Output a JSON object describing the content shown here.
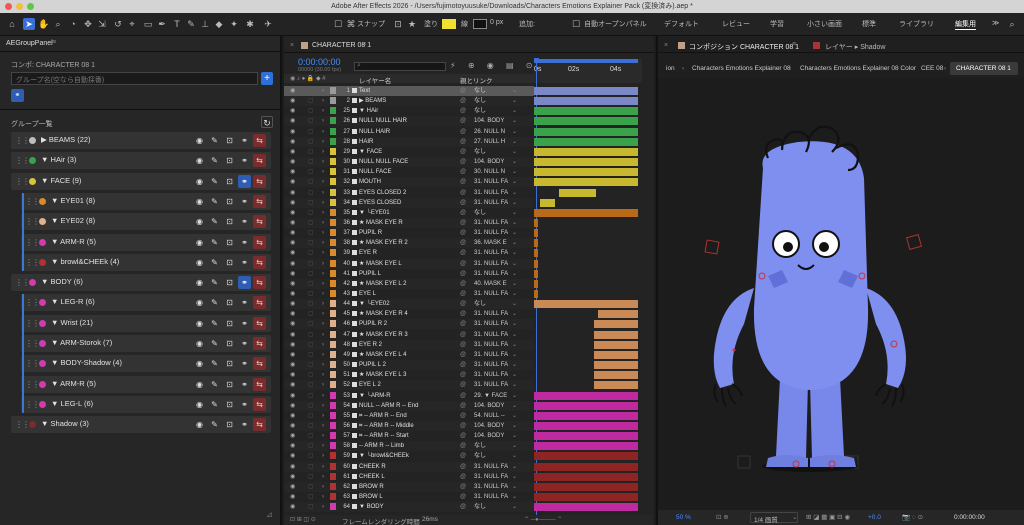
{
  "window": {
    "title": "Adobe After Effects 2026 - /Users/fujimotoyuusuke/Downloads/Characters Emotions Explainer Pack (変換済み).aep *"
  },
  "toolbar": {
    "snap_label": "スナップ",
    "fill_label": "塗り",
    "stroke_px": "0 px",
    "add_label": "追加:",
    "auto_open_label": "自動オープンパネル",
    "workspaces": [
      "デフォルト",
      "レビュー",
      "学習",
      "小さい画面",
      "標準",
      "ライブラリ",
      "編集用"
    ]
  },
  "left_panel": {
    "tab": "AEGroupPanel",
    "comp_label": "コンポ: CHARACTER 08 1",
    "group_name_placeholder": "グループ名(空なら自動採番)",
    "group_list_label": "グループ一覧",
    "groups": [
      {
        "name": "BEAMS (22)",
        "color": "#bdbdbd",
        "arrow": "▶",
        "indent": 0
      },
      {
        "name": "HAir (3)",
        "color": "#3aa24a",
        "arrow": "▼",
        "indent": 0
      },
      {
        "name": "FACE (9)",
        "color": "#d8c33a",
        "arrow": "▼",
        "indent": 0
      },
      {
        "name": "EYE01 (8)",
        "color": "#d98a2a",
        "arrow": "▼",
        "indent": 1
      },
      {
        "name": "EYE02 (8)",
        "color": "#e0b08a",
        "arrow": "▼",
        "indent": 1
      },
      {
        "name": "ARM-R (5)",
        "color": "#d23ab0",
        "arrow": "▼",
        "indent": 1
      },
      {
        "name": "browl&CHEEk (4)",
        "color": "#b23232",
        "arrow": "▼",
        "indent": 1
      },
      {
        "name": "BODY (6)",
        "color": "#d23ab0",
        "arrow": "▼",
        "indent": 0
      },
      {
        "name": "LEG-R (6)",
        "color": "#d23ab0",
        "arrow": "▼",
        "indent": 1
      },
      {
        "name": "Wrist (21)",
        "color": "#d23ab0",
        "arrow": "▼",
        "indent": 1
      },
      {
        "name": "ARM-Storok (7)",
        "color": "#d23ab0",
        "arrow": "▼",
        "indent": 1
      },
      {
        "name": "BODY-Shadow (4)",
        "color": "#d23ab0",
        "arrow": "▼",
        "indent": 1
      },
      {
        "name": "ARM-R (5)",
        "color": "#d23ab0",
        "arrow": "▼",
        "indent": 1
      },
      {
        "name": "LEG-L (6)",
        "color": "#d23ab0",
        "arrow": "▼",
        "indent": 1
      },
      {
        "name": "Shadow (3)",
        "color": "#7a2c2c",
        "arrow": "▼",
        "indent": 0
      }
    ]
  },
  "timeline": {
    "tab": "CHARACTER 08 1",
    "timecode": "0:00:00:00",
    "fps": "00000 (30.00 fps)",
    "col_layer_name": "レイヤー名",
    "col_parent": "親とリンク",
    "ruler": [
      "0s",
      "02s",
      "04s"
    ],
    "footer": "フレームレンダリング時間",
    "footer_time": "26ms",
    "layers": [
      {
        "n": "1",
        "name": "Text",
        "parent": "なし",
        "col": "#9a9a9a",
        "bar": "#7a88c8",
        "b0": 0,
        "b1": 100,
        "sel": true
      },
      {
        "n": "2",
        "name": "▶ BEAMS",
        "parent": "なし",
        "col": "#9a9a9a",
        "bar": "#7a88c8",
        "b0": 0,
        "b1": 100
      },
      {
        "n": "25",
        "name": "▼ HAir",
        "parent": "なし",
        "col": "#3aa24a",
        "bar": "#3aa24a",
        "b0": 0,
        "b1": 100
      },
      {
        "n": "26",
        "name": "NULL NULL HAIR",
        "parent": "104. BODY",
        "col": "#3aa24a",
        "bar": "#3aa24a",
        "b0": 0,
        "b1": 100
      },
      {
        "n": "27",
        "name": "NULL HAIR",
        "parent": "26. NULL N",
        "col": "#3aa24a",
        "bar": "#3aa24a",
        "b0": 0,
        "b1": 100
      },
      {
        "n": "28",
        "name": "HAIR",
        "parent": "27. NULL H",
        "col": "#3aa24a",
        "bar": "#3aa24a",
        "b0": 0,
        "b1": 100
      },
      {
        "n": "29",
        "name": "▼ FACE",
        "parent": "なし",
        "col": "#d8c33a",
        "bar": "#c8b830",
        "b0": 0,
        "b1": 100
      },
      {
        "n": "30",
        "name": "NULL NULL FACE",
        "parent": "104. BODY",
        "col": "#d8c33a",
        "bar": "#c8b830",
        "b0": 0,
        "b1": 100
      },
      {
        "n": "31",
        "name": "NULL FACE",
        "parent": "30. NULL N",
        "col": "#d8c33a",
        "bar": "#c8b830",
        "b0": 0,
        "b1": 100
      },
      {
        "n": "32",
        "name": "MOUTH",
        "parent": "31. NULL FA",
        "col": "#d8c33a",
        "bar": "#c8b830",
        "b0": 0,
        "b1": 100
      },
      {
        "n": "33",
        "name": "EYES CLOSED 2",
        "parent": "31. NULL FA",
        "col": "#d8c33a",
        "bar": "#c8b830",
        "b0": 24,
        "b1": 60
      },
      {
        "n": "34",
        "name": "EYES CLOSED",
        "parent": "31. NULL FA",
        "col": "#d8c33a",
        "bar": "#c8b830",
        "b0": 6,
        "b1": 20
      },
      {
        "n": "35",
        "name": "▼ └EYE01",
        "parent": "なし",
        "col": "#d98a2a",
        "bar": "#b86a18",
        "b0": 0,
        "b1": 100
      },
      {
        "n": "36",
        "name": "★ MASK EYE R",
        "parent": "31. NULL FA",
        "col": "#d98a2a",
        "bar": "#b86a18",
        "b0": 0,
        "b1": 4
      },
      {
        "n": "37",
        "name": "PUPIL R",
        "parent": "31. NULL FA",
        "col": "#d98a2a",
        "bar": "#b86a18",
        "b0": 0,
        "b1": 4
      },
      {
        "n": "38",
        "name": "★ MASK EYE R 2",
        "parent": "36. MASK E",
        "col": "#d98a2a",
        "bar": "#b86a18",
        "b0": 0,
        "b1": 4
      },
      {
        "n": "39",
        "name": "EYE R",
        "parent": "31. NULL FA",
        "col": "#d98a2a",
        "bar": "#b86a18",
        "b0": 0,
        "b1": 4
      },
      {
        "n": "40",
        "name": "★ MASK EYE L",
        "parent": "31. NULL FA",
        "col": "#d98a2a",
        "bar": "#b86a18",
        "b0": 0,
        "b1": 4
      },
      {
        "n": "41",
        "name": "PUPIL L",
        "parent": "31. NULL FA",
        "col": "#d98a2a",
        "bar": "#b86a18",
        "b0": 0,
        "b1": 4
      },
      {
        "n": "42",
        "name": "★ MASK EYE L 2",
        "parent": "40. MASK E",
        "col": "#d98a2a",
        "bar": "#b86a18",
        "b0": 0,
        "b1": 4
      },
      {
        "n": "43",
        "name": "EYE L",
        "parent": "31. NULL FA",
        "col": "#d98a2a",
        "bar": "#b86a18",
        "b0": 0,
        "b1": 4
      },
      {
        "n": "44",
        "name": "▼ └EYE02",
        "parent": "なし",
        "col": "#e0b08a",
        "bar": "#c98a55",
        "b0": 0,
        "b1": 100
      },
      {
        "n": "45",
        "name": "★ MASK EYE R 4",
        "parent": "31. NULL FA",
        "col": "#e0b08a",
        "bar": "#c98a55",
        "b0": 62,
        "b1": 100
      },
      {
        "n": "46",
        "name": "PUPIL R 2",
        "parent": "31. NULL FA",
        "col": "#e0b08a",
        "bar": "#c98a55",
        "b0": 58,
        "b1": 100
      },
      {
        "n": "47",
        "name": "★ MASK EYE R 3",
        "parent": "31. NULL FA",
        "col": "#e0b08a",
        "bar": "#c98a55",
        "b0": 58,
        "b1": 100
      },
      {
        "n": "48",
        "name": "EYE R 2",
        "parent": "31. NULL FA",
        "col": "#e0b08a",
        "bar": "#c98a55",
        "b0": 58,
        "b1": 100
      },
      {
        "n": "49",
        "name": "★ MASK EYE L 4",
        "parent": "31. NULL FA",
        "col": "#e0b08a",
        "bar": "#c98a55",
        "b0": 58,
        "b1": 100
      },
      {
        "n": "50",
        "name": "PUPIL L 2",
        "parent": "31. NULL FA",
        "col": "#e0b08a",
        "bar": "#c98a55",
        "b0": 58,
        "b1": 100
      },
      {
        "n": "51",
        "name": "★ MASK EYE L 3",
        "parent": "31. NULL FA",
        "col": "#e0b08a",
        "bar": "#c98a55",
        "b0": 58,
        "b1": 100
      },
      {
        "n": "52",
        "name": "EYE L 2",
        "parent": "31. NULL FA",
        "col": "#e0b08a",
        "bar": "#c98a55",
        "b0": 58,
        "b1": 100
      },
      {
        "n": "53",
        "name": "▼ └ARM-R",
        "parent": "29. ▼ FACE",
        "col": "#d23ab0",
        "bar": "#c02aa0",
        "b0": 0,
        "b1": 100
      },
      {
        "n": "54",
        "name": "NULL -- ARM R -- End",
        "parent": "104. BODY",
        "col": "#d23ab0",
        "bar": "#c02aa0",
        "b0": 0,
        "b1": 100
      },
      {
        "n": "55",
        "name": "⌗ -- ARM R -- End",
        "parent": "54. NULL --",
        "col": "#d23ab0",
        "bar": "#c02aa0",
        "b0": 0,
        "b1": 100
      },
      {
        "n": "56",
        "name": "⌗ -- ARM R -- Middle",
        "parent": "104. BODY",
        "col": "#d23ab0",
        "bar": "#c02aa0",
        "b0": 0,
        "b1": 100
      },
      {
        "n": "57",
        "name": "⌗ -- ARM R -- Start",
        "parent": "104. BODY",
        "col": "#d23ab0",
        "bar": "#c02aa0",
        "b0": 0,
        "b1": 100
      },
      {
        "n": "58",
        "name": "-- ARM R -- Limb",
        "parent": "なし",
        "col": "#d23ab0",
        "bar": "#c02aa0",
        "b0": 0,
        "b1": 100
      },
      {
        "n": "59",
        "name": "▼ └browl&CHEEk",
        "parent": "なし",
        "col": "#b23232",
        "bar": "#8e2424",
        "b0": 0,
        "b1": 100
      },
      {
        "n": "60",
        "name": "CHEEK R",
        "parent": "31. NULL FA",
        "col": "#b23232",
        "bar": "#8e2424",
        "b0": 0,
        "b1": 100
      },
      {
        "n": "61",
        "name": "CHEEK L",
        "parent": "31. NULL FA",
        "col": "#b23232",
        "bar": "#8e2424",
        "b0": 0,
        "b1": 100
      },
      {
        "n": "62",
        "name": "BROW R",
        "parent": "31. NULL FA",
        "col": "#b23232",
        "bar": "#8e2424",
        "b0": 0,
        "b1": 100
      },
      {
        "n": "63",
        "name": "BROW L",
        "parent": "31. NULL FA",
        "col": "#b23232",
        "bar": "#8e2424",
        "b0": 0,
        "b1": 100
      },
      {
        "n": "64",
        "name": "▼ BODY",
        "parent": "なし",
        "col": "#d23ab0",
        "bar": "#c02aa0",
        "b0": 0,
        "b1": 100
      }
    ]
  },
  "comp": {
    "tab": "コンポジション CHARACTER 08 1",
    "layer_tab": "レイヤー ▸ Shadow",
    "breadcrumbs": [
      "ion",
      "Characters Emotions Explainer 08",
      "Characters Emotions Explainer 08 Color",
      "CEE 08",
      "CHARACTER 08 1"
    ],
    "zoom": "50 %",
    "resolution": "1/4 画質",
    "exposure": "+0.0",
    "timecode": "0:00:00:00"
  },
  "colors": {
    "accent": "#3a6fd8",
    "character": "#7f8ff0"
  }
}
